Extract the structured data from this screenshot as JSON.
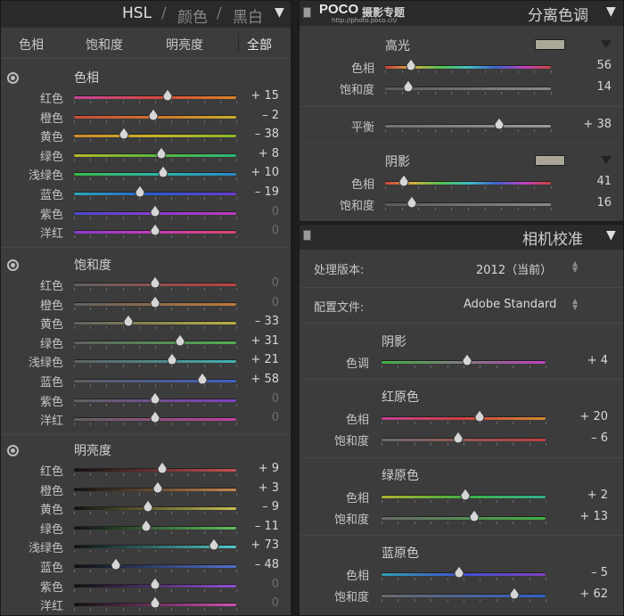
{
  "hsl": {
    "header": {
      "hsl": "HSL",
      "sep1": "/",
      "color": "颜色",
      "sep2": "/",
      "bw": "黑白",
      "collapse": "▼"
    },
    "tabs": [
      "色相",
      "饱和度",
      "明亮度",
      "全部"
    ],
    "active_tab": 3,
    "hue": {
      "title": "色相",
      "rows": [
        {
          "label": "红色",
          "value": "+ 15",
          "num": 15
        },
        {
          "label": "橙色",
          "value": "– 2",
          "num": -2
        },
        {
          "label": "黄色",
          "value": "– 38",
          "num": -38
        },
        {
          "label": "绿色",
          "value": "+ 8",
          "num": 8
        },
        {
          "label": "浅绿色",
          "value": "+ 10",
          "num": 10
        },
        {
          "label": "蓝色",
          "value": "– 19",
          "num": -19
        },
        {
          "label": "紫色",
          "value": "0",
          "num": 0
        },
        {
          "label": "洋红",
          "value": "0",
          "num": 0
        }
      ]
    },
    "saturation": {
      "title": "饱和度",
      "rows": [
        {
          "label": "红色",
          "value": "0",
          "num": 0
        },
        {
          "label": "橙色",
          "value": "0",
          "num": 0
        },
        {
          "label": "黄色",
          "value": "– 33",
          "num": -33
        },
        {
          "label": "绿色",
          "value": "+ 31",
          "num": 31
        },
        {
          "label": "浅绿色",
          "value": "+ 21",
          "num": 21
        },
        {
          "label": "蓝色",
          "value": "+ 58",
          "num": 58
        },
        {
          "label": "紫色",
          "value": "0",
          "num": 0
        },
        {
          "label": "洋红",
          "value": "0",
          "num": 0
        }
      ]
    },
    "luminance": {
      "title": "明亮度",
      "rows": [
        {
          "label": "红色",
          "value": "+ 9",
          "num": 9
        },
        {
          "label": "橙色",
          "value": "+ 3",
          "num": 3
        },
        {
          "label": "黄色",
          "value": "– 9",
          "num": -9
        },
        {
          "label": "绿色",
          "value": "– 11",
          "num": -11
        },
        {
          "label": "浅绿色",
          "value": "+ 73",
          "num": 73
        },
        {
          "label": "蓝色",
          "value": "– 48",
          "num": -48
        },
        {
          "label": "紫色",
          "value": "0",
          "num": 0
        },
        {
          "label": "洋红",
          "value": "0",
          "num": 0
        }
      ]
    }
  },
  "split_toning": {
    "brand": "POCO",
    "brand_sub": "摄影专题",
    "brand_url": "http://photo.poco.cn/",
    "header": "分离色调",
    "collapse": "▼",
    "highlights": {
      "title": "高光",
      "swatch_color": "#aaa99a",
      "hue": {
        "label": "色相",
        "value": "56",
        "num": 56
      },
      "saturation": {
        "label": "饱和度",
        "value": "14",
        "num": 14
      }
    },
    "balance": {
      "label": "平衡",
      "value": "+ 38",
      "num": 38
    },
    "shadows": {
      "title": "阴影",
      "swatch_color": "#aaa698",
      "hue": {
        "label": "色相",
        "value": "41",
        "num": 41
      },
      "saturation": {
        "label": "饱和度",
        "value": "16",
        "num": 16
      }
    }
  },
  "camera": {
    "header": "相机校准",
    "collapse": "▼",
    "process_label": "处理版本:",
    "process_value": "2012（当前）",
    "profile_label": "配置文件:",
    "profile_value": "Adobe Standard",
    "shadows": {
      "title": "阴影",
      "tint": {
        "label": "色调",
        "value": "+ 4",
        "num": 4
      }
    },
    "red": {
      "title": "红原色",
      "hue": {
        "label": "色相",
        "value": "+ 20",
        "num": 20
      },
      "saturation": {
        "label": "饱和度",
        "value": "– 6",
        "num": -6
      }
    },
    "green": {
      "title": "绿原色",
      "hue": {
        "label": "色相",
        "value": "+ 2",
        "num": 2
      },
      "saturation": {
        "label": "饱和度",
        "value": "+ 13",
        "num": 13
      }
    },
    "blue": {
      "title": "蓝原色",
      "hue": {
        "label": "色相",
        "value": "– 5",
        "num": -5
      },
      "saturation": {
        "label": "饱和度",
        "value": "+ 62",
        "num": 62
      }
    }
  },
  "colors": {
    "accent_text": "#d8d8d8",
    "panel_bg": "#3c3c3c",
    "header_bg": "#2a2a2a"
  }
}
